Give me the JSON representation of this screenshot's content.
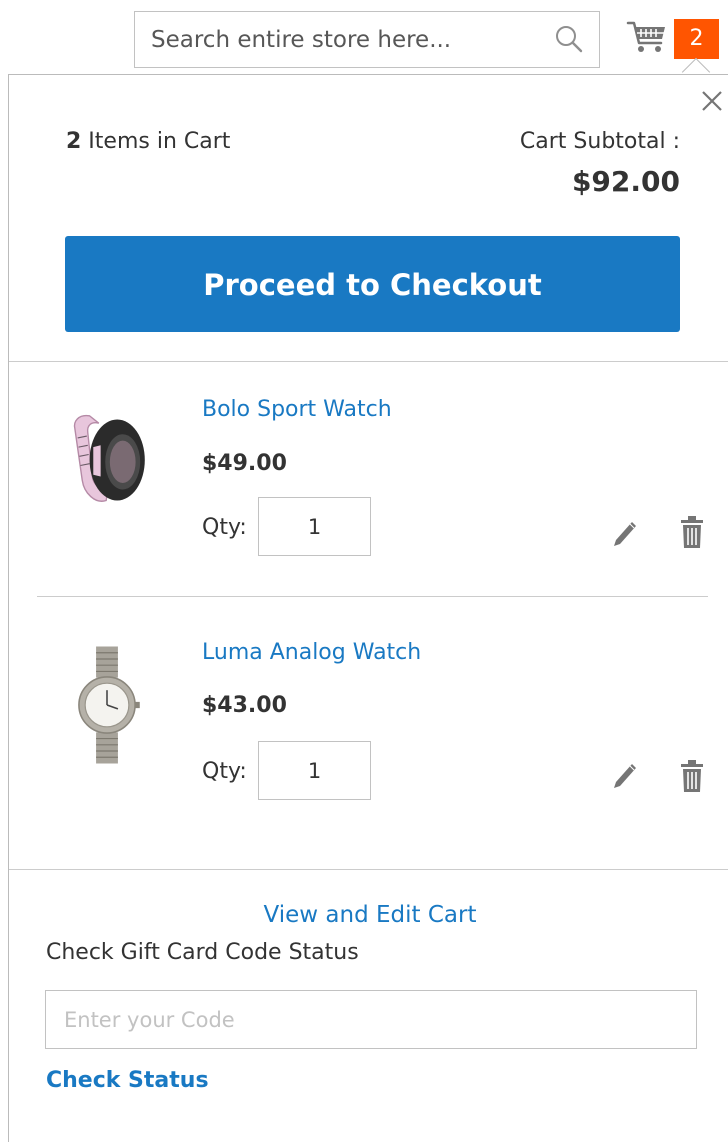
{
  "header": {
    "search_placeholder": "Search entire store here...",
    "search_icon": "search-icon",
    "cart_icon": "cart-icon",
    "cart_count": "2",
    "counter_color": "#ff5501"
  },
  "minicart": {
    "close_icon": "close-icon",
    "items_count": "2",
    "items_label": " Items in Cart",
    "subtotal_label": "Cart Subtotal :",
    "subtotal_amount": "$92.00",
    "checkout_label": "Proceed to Checkout",
    "checkout_color": "#1979c3",
    "items": [
      {
        "name": "Bolo Sport Watch",
        "price": "$49.00",
        "qty_label": "Qty:",
        "qty": "1",
        "image_icon": "bolo-sport-watch-image",
        "edit_icon": "pencil-icon",
        "remove_icon": "trash-icon"
      },
      {
        "name": "Luma Analog Watch",
        "price": "$43.00",
        "qty_label": "Qty:",
        "qty": "1",
        "image_icon": "luma-analog-watch-image",
        "edit_icon": "pencil-icon",
        "remove_icon": "trash-icon"
      }
    ],
    "view_cart_label": "View and Edit Cart",
    "giftcard": {
      "heading": "Check Gift Card Code Status",
      "placeholder": "Enter your Code",
      "check_label": "Check Status"
    },
    "link_color": "#1979c3"
  }
}
